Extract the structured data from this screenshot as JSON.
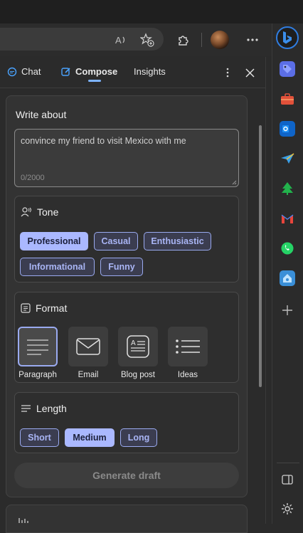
{
  "toolbar": {
    "icons": [
      "read-aloud-icon",
      "add-favorite-icon",
      "extensions-icon",
      "more-icon"
    ]
  },
  "tabs": [
    {
      "label": "Chat"
    },
    {
      "label": "Compose"
    },
    {
      "label": "Insights"
    }
  ],
  "compose": {
    "write_about_label": "Write about",
    "input_value": "convince my friend to visit Mexico with me",
    "char_count": "0/2000",
    "tone": {
      "title": "Tone",
      "options": [
        "Professional",
        "Casual",
        "Enthusiastic",
        "Informational",
        "Funny"
      ],
      "selected": "Professional"
    },
    "format": {
      "title": "Format",
      "options": [
        "Paragraph",
        "Email",
        "Blog post",
        "Ideas"
      ],
      "selected": "Paragraph"
    },
    "length": {
      "title": "Length",
      "options": [
        "Short",
        "Medium",
        "Long"
      ],
      "selected": "Medium"
    },
    "generate_label": "Generate draft"
  },
  "colors": {
    "accent": "#aab8ff",
    "chip_border": "#9aaaf0",
    "tab_underline": "#7db3ff",
    "bing_blue": "#2f7de1"
  }
}
